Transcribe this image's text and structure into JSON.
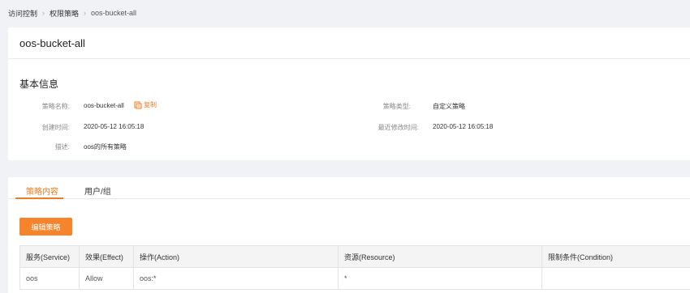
{
  "breadcrumb": {
    "items": [
      "访问控制",
      "权限策略"
    ],
    "current": "oos-bucket-all"
  },
  "policy": {
    "title": "oos-bucket-all",
    "section_title": "基本信息",
    "fields": {
      "name_label": "策略名称:",
      "name_value": "oos-bucket-all",
      "copy_label": "复制",
      "type_label": "策略类型:",
      "type_value": "自定义策略",
      "created_label": "创建时间:",
      "created_value": "2020-05-12 16:05:18",
      "modified_label": "最近修改时间:",
      "modified_value": "2020-05-12 16:05:18",
      "desc_label": "描述:",
      "desc_value": "oos的所有策略"
    }
  },
  "tabs": [
    {
      "label": "策略内容",
      "active": true
    },
    {
      "label": "用户/组",
      "active": false
    }
  ],
  "edit_button": "编辑策略",
  "table": {
    "headers": [
      "服务(Service)",
      "效果(Effect)",
      "操作(Action)",
      "资源(Resource)",
      "限制条件(Condition)"
    ],
    "rows": [
      [
        "oos",
        "Allow",
        "oos:*",
        "*",
        ""
      ]
    ]
  },
  "colors": {
    "accent": "#f07c21",
    "button": "#f5842c",
    "background": "#f0f2f5"
  }
}
